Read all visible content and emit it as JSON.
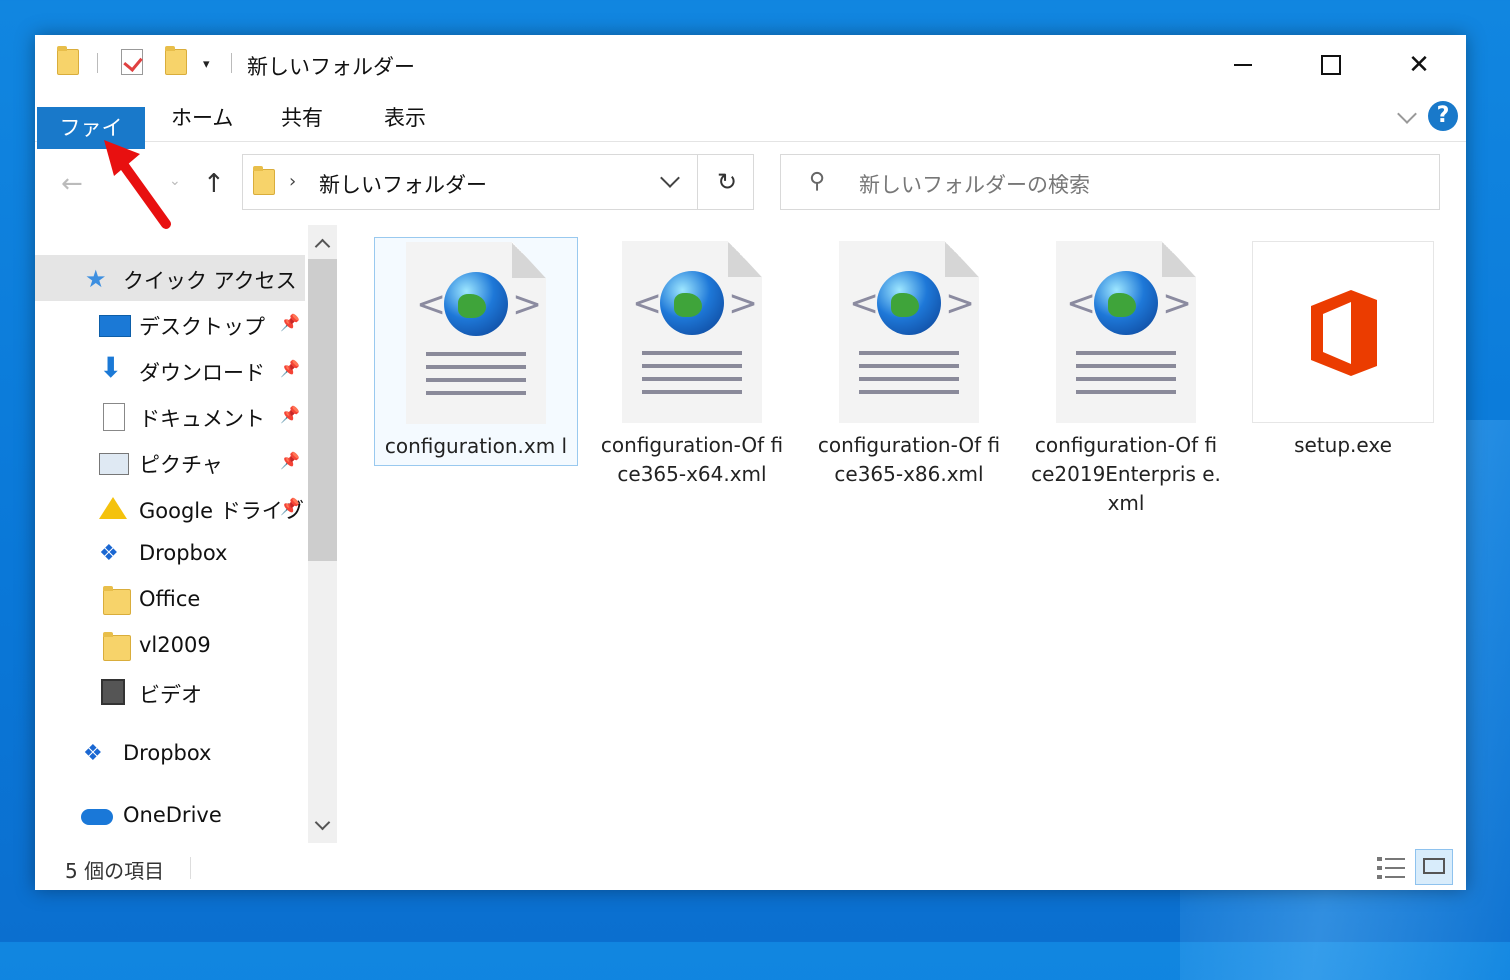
{
  "window": {
    "title": "新しいフォルダー",
    "minimize_label": "–",
    "maximize_label": "□",
    "close_label": "✕"
  },
  "quick_access_toolbar": {
    "dropdown": "▾"
  },
  "ribbon": {
    "tabs": [
      "ファイル",
      "ホーム",
      "共有",
      "表示"
    ],
    "active_tab": "ファイル",
    "help": "?"
  },
  "address_bar": {
    "path_separator": "›",
    "path": "新しいフォルダー",
    "refresh": "↻"
  },
  "search": {
    "placeholder": "新しいフォルダーの検索"
  },
  "nav_pane": {
    "quick_access": "クイック アクセス",
    "items": [
      {
        "label": "デスクトップ",
        "icon": "desktop-icon",
        "pinned": true
      },
      {
        "label": "ダウンロード",
        "icon": "download-icon",
        "pinned": true
      },
      {
        "label": "ドキュメント",
        "icon": "documents-icon",
        "pinned": true
      },
      {
        "label": "ピクチャ",
        "icon": "pictures-icon",
        "pinned": true
      },
      {
        "label": "Google ドライブ",
        "icon": "google-drive-icon",
        "pinned": true
      },
      {
        "label": "Dropbox",
        "icon": "dropbox-icon",
        "pinned": false
      },
      {
        "label": "Office",
        "icon": "folder-icon",
        "pinned": false
      },
      {
        "label": "vl2009",
        "icon": "folder-icon",
        "pinned": false
      },
      {
        "label": "ビデオ",
        "icon": "videos-icon",
        "pinned": false
      }
    ],
    "roots": [
      {
        "label": "Dropbox",
        "icon": "dropbox-icon"
      },
      {
        "label": "OneDrive",
        "icon": "onedrive-icon"
      }
    ]
  },
  "files": [
    {
      "name": "configuration.xml",
      "display": "configuration.xm l",
      "type": "xml",
      "selected": true
    },
    {
      "name": "configuration-Office365-x64.xml",
      "display": "configuration-Of fice365-x64.xml",
      "type": "xml",
      "selected": false
    },
    {
      "name": "configuration-Office365-x86.xml",
      "display": "configuration-Of fice365-x86.xml",
      "type": "xml",
      "selected": false
    },
    {
      "name": "configuration-Office2019Enterprise.xml",
      "display": "configuration-Of fice2019Enterpris e.xml",
      "type": "xml",
      "selected": false
    },
    {
      "name": "setup.exe",
      "display": "setup.exe",
      "type": "exe-office",
      "selected": false
    }
  ],
  "status_bar": {
    "item_count": "5 個の項目"
  },
  "colors": {
    "accent": "#1979ca",
    "annotation": "#e81010",
    "desktop": "#0a78d8"
  }
}
